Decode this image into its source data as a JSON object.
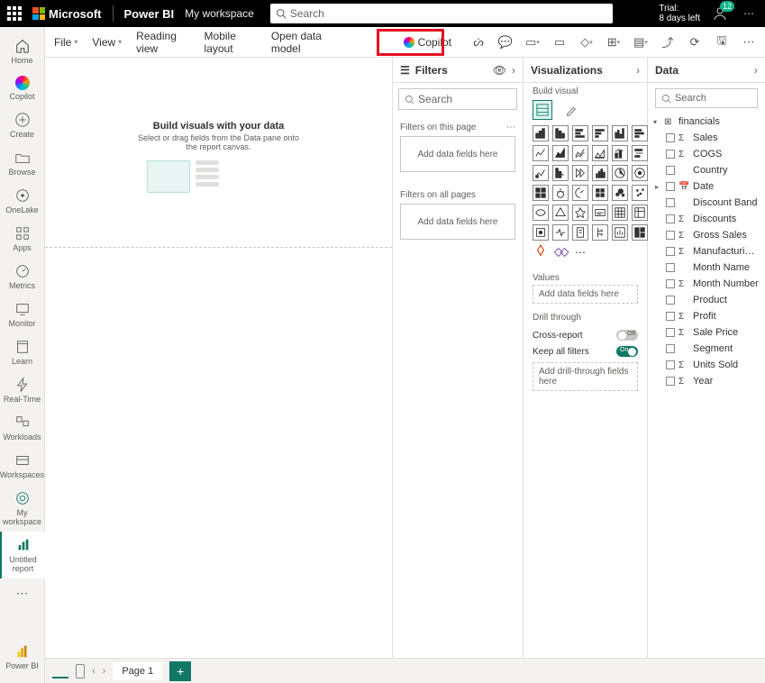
{
  "topbar": {
    "brand": "Microsoft",
    "product": "Power BI",
    "workspace": "My workspace",
    "search_placeholder": "Search",
    "trial_line1": "Trial:",
    "trial_line2": "8 days left",
    "notif_count": "12"
  },
  "leftrail": {
    "items": [
      {
        "label": "Home"
      },
      {
        "label": "Copilot"
      },
      {
        "label": "Create"
      },
      {
        "label": "Browse"
      },
      {
        "label": "OneLake"
      },
      {
        "label": "Apps"
      },
      {
        "label": "Metrics"
      },
      {
        "label": "Monitor"
      },
      {
        "label": "Learn"
      },
      {
        "label": "Real-Time"
      },
      {
        "label": "Workloads"
      },
      {
        "label": "Workspaces"
      },
      {
        "label": "My workspace"
      },
      {
        "label": "Untitled report"
      }
    ],
    "bottom_label": "Power BI"
  },
  "toolbar": {
    "file": "File",
    "view": "View",
    "reading": "Reading view",
    "mobile": "Mobile layout",
    "opendata": "Open data model",
    "copilot": "Copilot"
  },
  "canvas": {
    "heading": "Build visuals with your data",
    "sub": "Select or drag fields from the Data pane onto the report canvas."
  },
  "filters": {
    "title": "Filters",
    "search_placeholder": "Search",
    "on_page": "Filters on this page",
    "on_all": "Filters on all pages",
    "drop": "Add data fields here"
  },
  "viz": {
    "title": "Visualizations",
    "subtitle": "Build visual",
    "values": "Values",
    "values_drop": "Add data fields here",
    "drill": "Drill through",
    "cross": "Cross-report",
    "keep": "Keep all filters",
    "drill_drop": "Add drill-through fields here",
    "off": "Off",
    "on": "On"
  },
  "data": {
    "title": "Data",
    "search_placeholder": "Search",
    "table": "financials",
    "fields": [
      {
        "label": "Sales",
        "icon": "Σ"
      },
      {
        "label": "COGS",
        "icon": "Σ"
      },
      {
        "label": "Country",
        "icon": ""
      },
      {
        "label": "Date",
        "icon": "📅",
        "expandable": true
      },
      {
        "label": "Discount Band",
        "icon": ""
      },
      {
        "label": "Discounts",
        "icon": "Σ"
      },
      {
        "label": "Gross Sales",
        "icon": "Σ"
      },
      {
        "label": "Manufacturing ...",
        "icon": "Σ"
      },
      {
        "label": "Month Name",
        "icon": ""
      },
      {
        "label": "Month Number",
        "icon": "Σ"
      },
      {
        "label": "Product",
        "icon": ""
      },
      {
        "label": "Profit",
        "icon": "Σ"
      },
      {
        "label": "Sale Price",
        "icon": "Σ"
      },
      {
        "label": "Segment",
        "icon": ""
      },
      {
        "label": "Units Sold",
        "icon": "Σ"
      },
      {
        "label": "Year",
        "icon": "Σ"
      }
    ]
  },
  "pagetabs": {
    "page1": "Page 1"
  }
}
